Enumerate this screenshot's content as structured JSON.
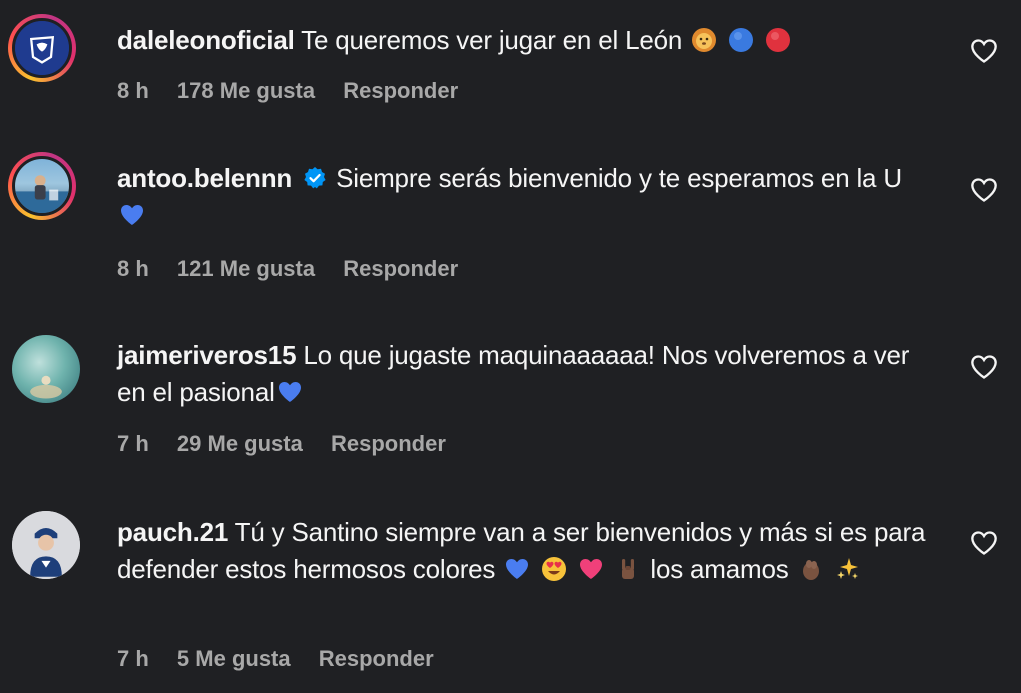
{
  "comments": [
    {
      "username": "daleleonoficial",
      "verified": false,
      "text": "Te queremos ver jugar en el León",
      "emojis_after": [
        "lion-emoji",
        "blue-circle-emoji",
        "red-circle-emoji"
      ],
      "time": "8 h",
      "likes": "178 Me gusta",
      "reply_label": "Responder"
    },
    {
      "username": "antoo.belennn",
      "verified": true,
      "text": "Siempre serás bienvenido y te esperamos en la U",
      "emojis_after": [
        "blue-heart-emoji"
      ],
      "time": "8 h",
      "likes": "121 Me gusta",
      "reply_label": "Responder"
    },
    {
      "username": "jaimeriveros15",
      "verified": false,
      "text": "Lo que jugaste maquinaaaaaa! Nos volveremos a ver en el pasional",
      "emojis_after": [
        "blue-heart-emoji"
      ],
      "time": "7 h",
      "likes": "29 Me gusta",
      "reply_label": "Responder"
    },
    {
      "username": "pauch.21",
      "verified": false,
      "text_part1": "Tú y Santino siempre van a ser bienvenidos y más si es para defender estos hermosos colores",
      "text_part2": "los amamos",
      "time": "7 h",
      "likes": "5 Me gusta",
      "reply_label": "Responder"
    }
  ],
  "colors": {
    "background": "#1f2023",
    "text": "#f5f5f5",
    "meta": "#a8a8a8",
    "verified": "#0095f6",
    "blue_heart": "#4a7df0"
  }
}
